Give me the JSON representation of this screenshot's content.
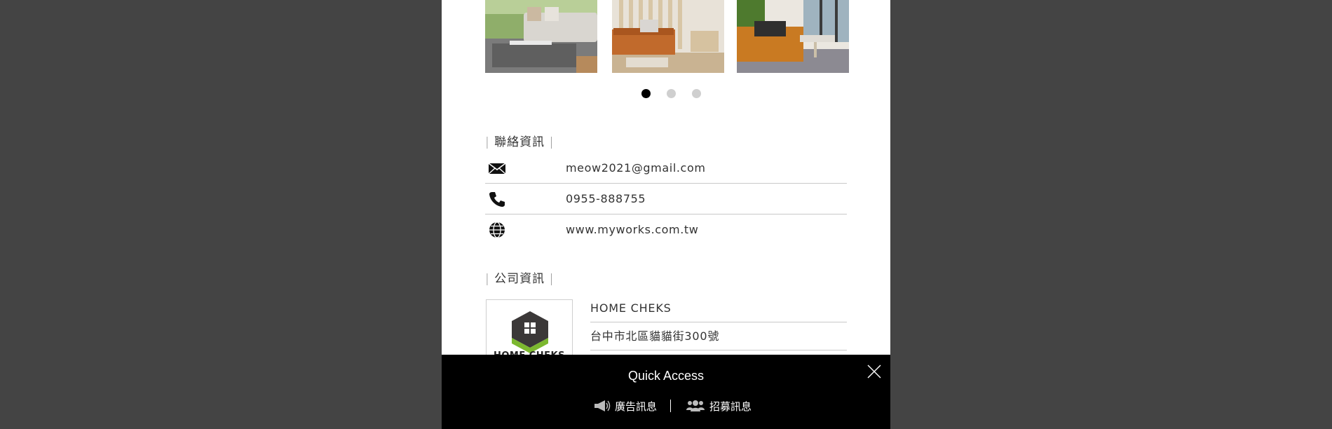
{
  "gallery": {
    "images": [
      {
        "alt_icon": "living-room-photo"
      },
      {
        "alt_icon": "living-room-photo"
      },
      {
        "alt_icon": "living-room-photo"
      }
    ],
    "active_index": 0,
    "dot_count": 3
  },
  "contact": {
    "title": "聯絡資訊",
    "email": "meow2021@gmail.com",
    "phone": "0955-888755",
    "website": "www.myworks.com.tw",
    "icons": [
      "mail-icon",
      "phone-icon",
      "globe-icon"
    ]
  },
  "company": {
    "title": "公司資訊",
    "name": "HOME CHEKS",
    "address": "台中市北區貓貓街300號",
    "logo_text": "HOME CHEKS"
  },
  "quick_access": {
    "title": "Quick Access",
    "links": [
      {
        "label": "廣告訊息",
        "icon": "megaphone-icon"
      },
      {
        "label": "招募訊息",
        "icon": "users-icon"
      }
    ]
  },
  "colors": {
    "backdrop": "#444444",
    "page": "#ffffff",
    "quick_access_bg": "#000000",
    "accent_green": "#7cb82f"
  }
}
